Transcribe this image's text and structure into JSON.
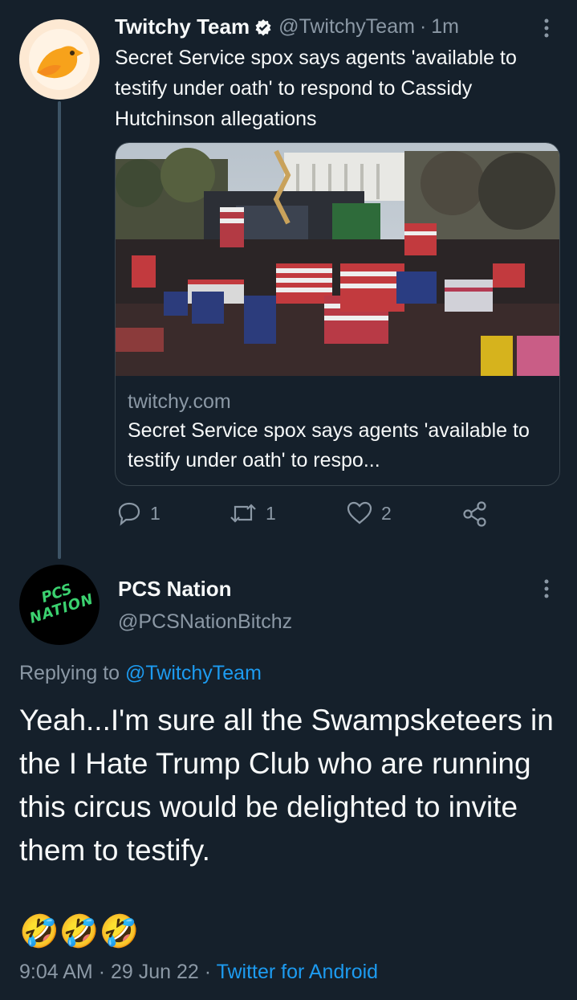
{
  "tweet": {
    "author_name": "Twitchy Team",
    "handle": "@TwitchyTeam",
    "separator": "·",
    "time": "1m",
    "text": "Secret Service spox says agents 'available to testify under oath' to respond to Cassidy Hutchinson allegations",
    "card": {
      "domain": "twitchy.com",
      "title": "Secret Service spox says agents 'available to testify under oath' to respo...",
      "image_icon": "rally-crowd-photo"
    },
    "actions": {
      "reply_count": "1",
      "retweet_count": "1",
      "like_count": "2"
    }
  },
  "reply": {
    "author_name": "PCS Nation",
    "handle": "@PCSNationBitchz",
    "avatar_text_line1": "PCS",
    "avatar_text_line2": "NATION",
    "replying_to_label": "Replying to",
    "replying_to_handle": "@TwitchyTeam",
    "text": "Yeah...I'm sure all the Swampsketeers in the I Hate Trump Club who are running this circus would be delighted to invite them to testify.",
    "emojis": "🤣🤣🤣",
    "time": "9:04 AM",
    "date": "29 Jun 22",
    "client": "Twitter for Android"
  },
  "colors": {
    "background": "#15202b",
    "text": "#f7f9f9",
    "muted": "#8b98a5",
    "link": "#1d9bf0",
    "verified_badge": "#f7f9f9",
    "avatar_pcs_text": "#3bd16f"
  }
}
